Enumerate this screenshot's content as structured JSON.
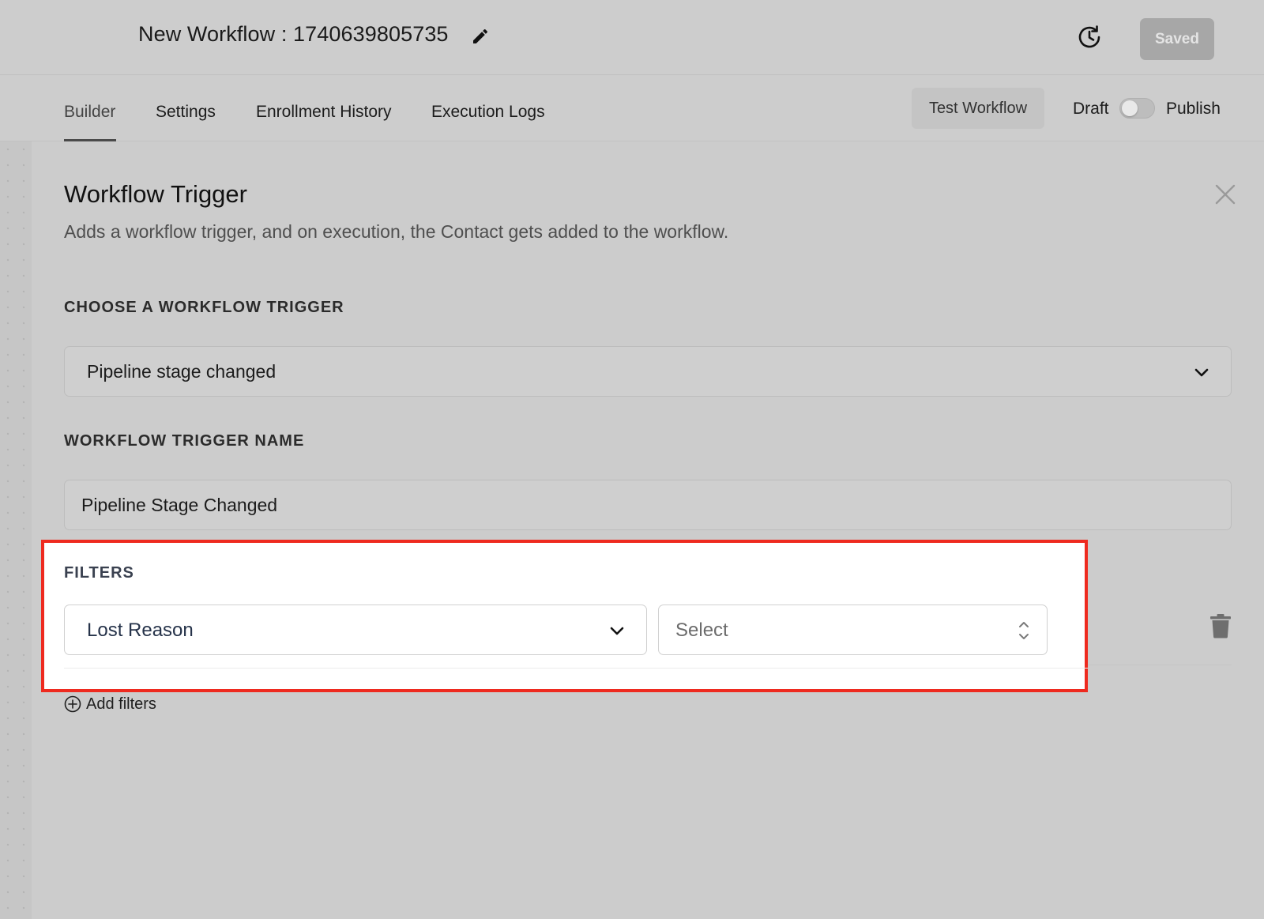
{
  "header": {
    "workflow_title": "New Workflow : 1740639805735",
    "saved_label": "Saved",
    "icons": {
      "edit": "pencil-icon",
      "history": "history-icon"
    }
  },
  "tabs": [
    {
      "label": "Builder",
      "active": true
    },
    {
      "label": "Settings",
      "active": false
    },
    {
      "label": "Enrollment History",
      "active": false
    },
    {
      "label": "Execution Logs",
      "active": false
    }
  ],
  "toolbar": {
    "test_workflow_label": "Test Workflow",
    "draft_label": "Draft",
    "publish_label": "Publish",
    "publish_toggle_on": false
  },
  "panel": {
    "title": "Workflow Trigger",
    "description": "Adds a workflow trigger, and on execution, the Contact gets added to the workflow.",
    "choose_trigger_label": "CHOOSE A WORKFLOW TRIGGER",
    "trigger_value": "Pipeline stage changed",
    "trigger_name_label": "WORKFLOW TRIGGER NAME",
    "trigger_name_value": "Pipeline Stage Changed"
  },
  "filters": {
    "label": "FILTERS",
    "field_value": "Lost Reason",
    "value_placeholder": "Select",
    "add_label": "Add filters"
  },
  "colors": {
    "highlight": "#ee2a1f",
    "overlay": "#cccccc",
    "saved_button": "#a7a7a7"
  }
}
